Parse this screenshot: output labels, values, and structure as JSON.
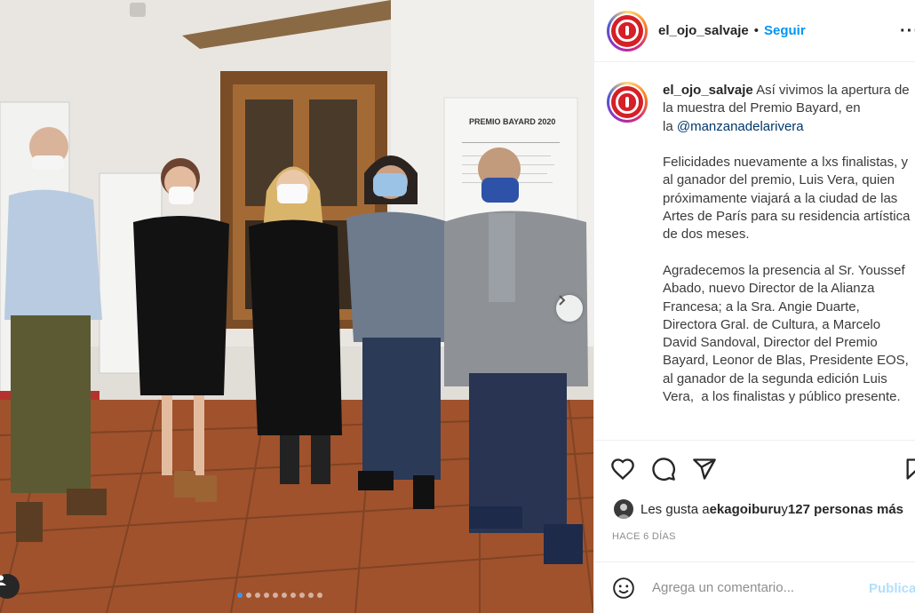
{
  "post": {
    "username": "el_ojo_salvaje",
    "separator": "•",
    "follow_label": "Seguir",
    "more_label": "···",
    "caption_user": "el_ojo_salvaje",
    "caption_part1": " Así vivimos la apertura de\nla muestra del Premio Bayard, en\nla ",
    "caption_mention": "@manzanadelarivera",
    "caption_part2": "\n\nFelicidades nuevamente a lxs finalistas, y\nal ganador del premio, Luis Vera, quien\npróximamente viajará a la ciudad de las\nArtes de París para su residencia artística\nde dos meses.\n\nAgradecemos la presencia al Sr. Youssef\nAbado, nuevo Director de la Alianza\nFrancesa; a la Sra. Angie Duarte,\nDirectora Gral. de Cultura, a Marcelo\nDavid Sandoval, Director del Premio\nBayard, Leonor de Blas, Presidente EOS,\nal ganador de la segunda edición Luis\nVera,  a los finalistas y público presente.",
    "likes_prefix": "Les gusta a ",
    "likes_user": "ekagoiburu",
    "likes_middle": " y ",
    "likes_count": "127 personas más",
    "time_ago": "HACE 6 DÍAS",
    "comment_placeholder": "Agrega un comentario...",
    "publish_label": "Publicar"
  },
  "photo": {
    "banner_title": "PREMIO BAYARD 2020",
    "dots_total": 10,
    "dots_active_index": 0
  },
  "icons": {
    "like": "heart-icon",
    "comment": "comment-bubble-icon",
    "share": "paper-plane-icon",
    "save": "bookmark-icon",
    "emoji": "smiley-icon",
    "next": "chevron-right-icon",
    "tag": "user-tag-icon"
  },
  "colors": {
    "link": "#0095f6",
    "mention": "#00376b",
    "brand_red": "#d61f26"
  }
}
